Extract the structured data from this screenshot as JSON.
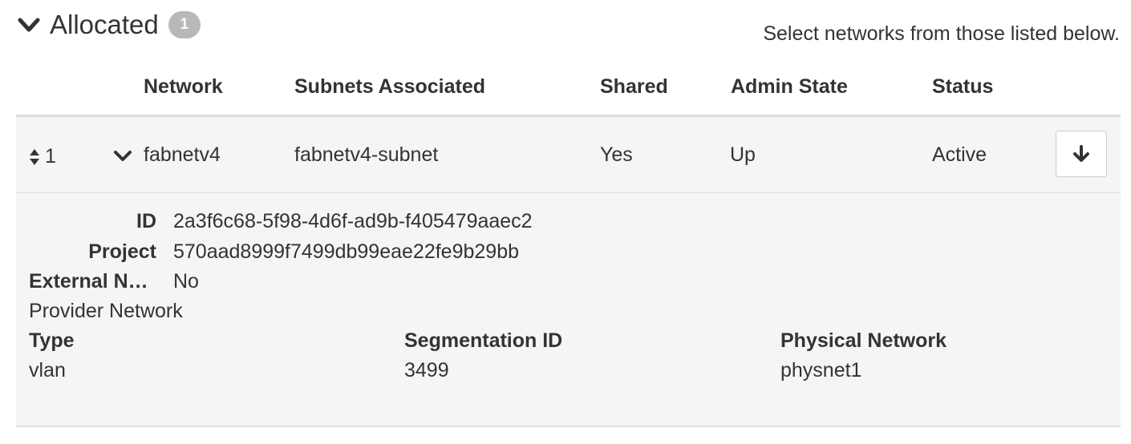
{
  "section": {
    "title": "Allocated",
    "count": "1",
    "help_text": "Select networks from those listed below."
  },
  "table": {
    "headers": {
      "network": "Network",
      "subnets": "Subnets Associated",
      "shared": "Shared",
      "admin_state": "Admin State",
      "status": "Status"
    },
    "row": {
      "index": "1",
      "network": "fabnetv4",
      "subnets": "fabnetv4-subnet",
      "shared": "Yes",
      "admin_state": "Up",
      "status": "Active",
      "action_icon": "arrow-down-icon"
    }
  },
  "detail": {
    "id_label": "ID",
    "id_value": "2a3f6c68-5f98-4d6f-ad9b-f405479aaec2",
    "project_label": "Project",
    "project_value": "570aad8999f7499db99eae22fe9b29bb",
    "external_label": "External N…",
    "external_value": "No",
    "provider_title": "Provider Network",
    "type_label": "Type",
    "type_value": "vlan",
    "segmentation_label": "Segmentation ID",
    "segmentation_value": "3499",
    "physical_label": "Physical Network",
    "physical_value": "physnet1"
  },
  "colors": {
    "text": "#333333",
    "badge_bg": "#b8b8b8",
    "row_bg": "#f5f5f5",
    "divider": "#dddddd"
  }
}
